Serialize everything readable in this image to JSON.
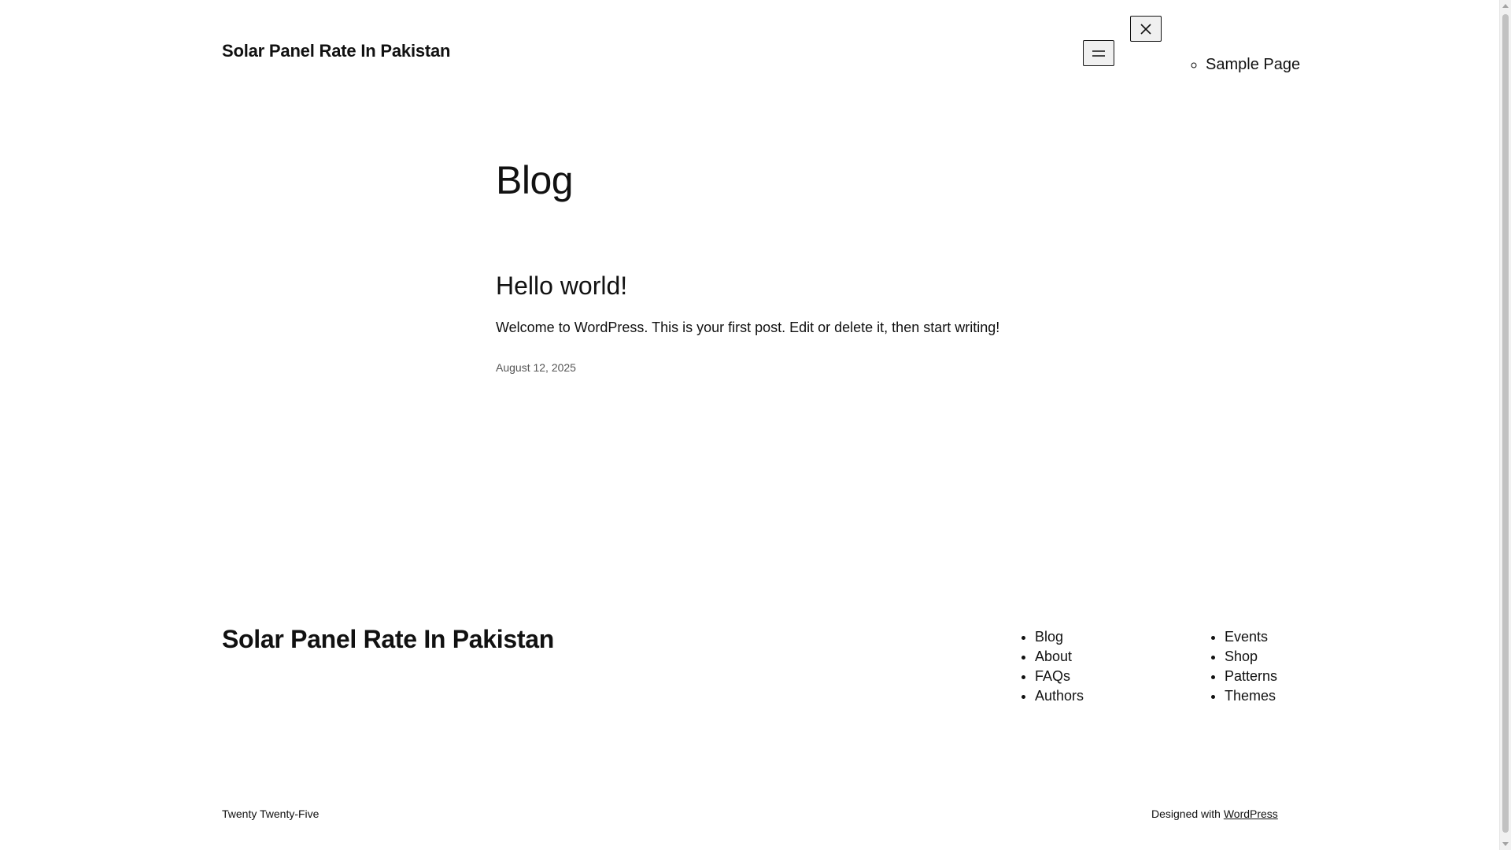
{
  "header": {
    "site_title": "Solar Panel Rate In Pakistan",
    "menu_open_icon": "hamburger-menu-icon",
    "menu_close_icon": "close-icon",
    "submenu": [
      {
        "label": "Sample Page"
      }
    ]
  },
  "main": {
    "page_title": "Blog",
    "posts": [
      {
        "title": "Hello world!",
        "excerpt": "Welcome to WordPress. This is your first post. Edit or delete it, then start writing!",
        "date": "August 12, 2025"
      }
    ]
  },
  "footer": {
    "site_title": "Solar Panel Rate In Pakistan",
    "nav_column_1": [
      {
        "label": "Blog"
      },
      {
        "label": "About"
      },
      {
        "label": "FAQs"
      },
      {
        "label": "Authors"
      }
    ],
    "nav_column_2": [
      {
        "label": "Events"
      },
      {
        "label": "Shop"
      },
      {
        "label": "Patterns"
      },
      {
        "label": "Themes"
      }
    ],
    "credit_left": "Twenty Twenty-Five",
    "credit_right_prefix": "Designed with",
    "credit_right_link": "WordPress"
  },
  "colors": {
    "text": "#111111",
    "background": "#ffffff",
    "muted": "#555555"
  }
}
